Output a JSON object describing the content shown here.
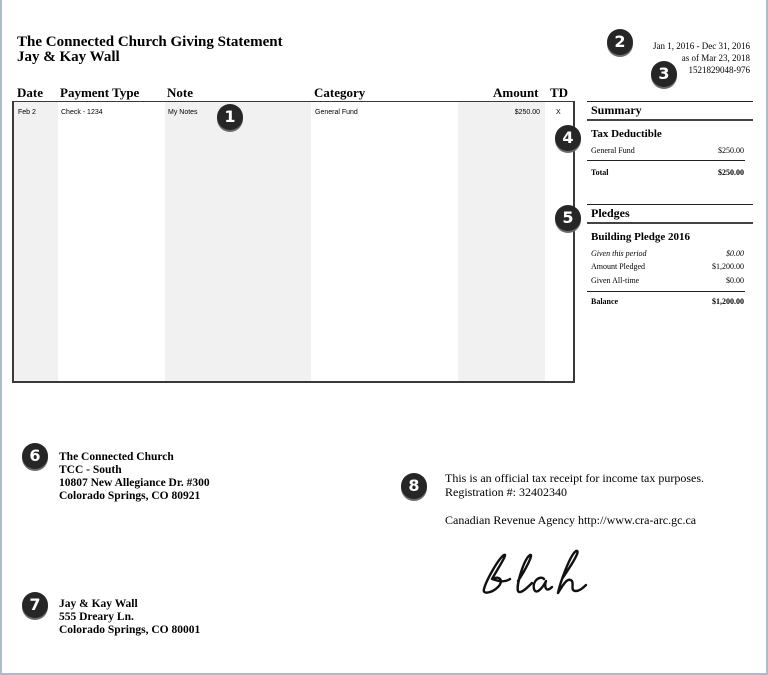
{
  "header": {
    "title": "The Connected Church Giving Statement",
    "donor": "Jay & Kay Wall",
    "date_range": "Jan 1, 2016 - Dec 31, 2016",
    "as_of": "as of Mar 23, 2018",
    "statement_id": "1521829048-976"
  },
  "table": {
    "columns": [
      "Date",
      "Payment Type",
      "Note",
      "Category",
      "Amount",
      "TD"
    ],
    "rows": [
      {
        "date": "Feb 2",
        "payment_type": "Check - 1234",
        "note": "My Notes",
        "category": "General Fund",
        "amount": "$250.00",
        "td": "X"
      }
    ]
  },
  "summary": {
    "heading": "Summary",
    "tax_deductible": {
      "heading": "Tax Deductible",
      "rows": [
        {
          "label": "General Fund",
          "value": "$250.00"
        }
      ],
      "total_label": "Total",
      "total_value": "$250.00"
    }
  },
  "pledges": {
    "heading": "Pledges",
    "pledge_name": "Building Pledge 2016",
    "rows": [
      {
        "label": "Given this period",
        "value": "$0.00"
      },
      {
        "label": "Amount Pledged",
        "value": "$1,200.00"
      },
      {
        "label": "Given All-time",
        "value": "$0.00"
      }
    ],
    "balance_label": "Balance",
    "balance_value": "$1,200.00"
  },
  "church_address": {
    "lines": [
      "The Connected Church",
      "TCC - South",
      "10807 New Allegiance Dr. #300",
      "Colorado Springs, CO  80921"
    ]
  },
  "donor_address": {
    "lines": [
      "Jay & Kay Wall",
      "555 Dreary Ln.",
      "Colorado Springs, CO  80001"
    ]
  },
  "receipt": {
    "line1": "This is an official tax receipt for income tax purposes.",
    "line2": "Registration #: 32402340",
    "line3": "Canadian Revenue Agency http://www.cra-arc.gc.ca"
  },
  "signature": {
    "text": "blah"
  },
  "badges": [
    "1",
    "2",
    "3",
    "4",
    "5",
    "6",
    "7",
    "8"
  ]
}
